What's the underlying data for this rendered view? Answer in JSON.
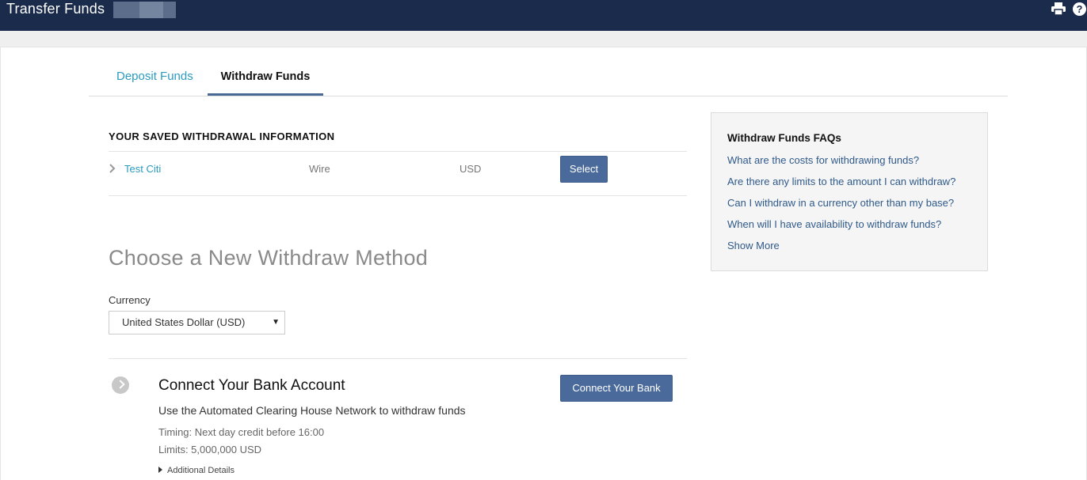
{
  "header": {
    "title": "Transfer Funds",
    "icons": [
      "print-icon",
      "help-icon"
    ]
  },
  "tabs": [
    {
      "label": "Deposit Funds",
      "active": false
    },
    {
      "label": "Withdraw Funds",
      "active": true
    }
  ],
  "saved": {
    "heading": "YOUR SAVED WITHDRAWAL INFORMATION",
    "rows": [
      {
        "name": "Test Citi",
        "method": "Wire",
        "currency": "USD",
        "button": "Select"
      }
    ]
  },
  "new_method": {
    "title": "Choose a New Withdraw Method",
    "currency_label": "Currency",
    "currency_value": "United States Dollar (USD)"
  },
  "bank": {
    "title": "Connect Your Bank Account",
    "description": "Use the Automated Clearing House Network to withdraw funds",
    "timing": "Timing: Next day credit before 16:00",
    "limits": "Limits: 5,000,000 USD",
    "details": "Additional Details",
    "button": "Connect Your Bank"
  },
  "faq": {
    "title": "Withdraw Funds FAQs",
    "links": [
      "What are the costs for withdrawing funds?",
      "Are there any limits to the amount I can withdraw?",
      "Can I withdraw in a currency other than my base?",
      "When will I have availability to withdraw funds?",
      "Show More"
    ]
  },
  "colors": {
    "header_bg": "#1b2b4b",
    "button_bg": "#4a6a9c",
    "link": "#2b9bc0",
    "faq_link": "#2f5a8a"
  }
}
